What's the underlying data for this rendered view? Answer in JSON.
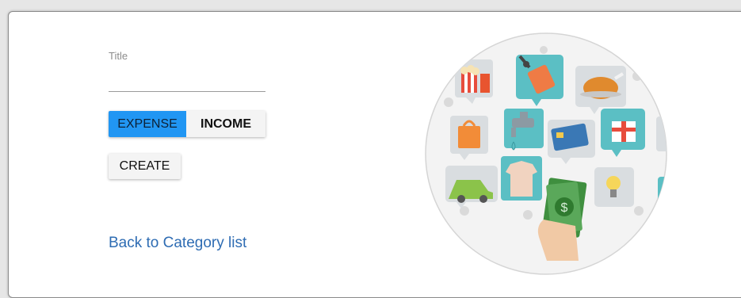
{
  "form": {
    "title_label": "Title",
    "title_value": "",
    "type_options": [
      "EXPENSE",
      "INCOME"
    ],
    "selected_type": "EXPENSE",
    "create_label": "CREATE"
  },
  "back_link_label": "Back to Category list",
  "illustration": {
    "icons": [
      "popcorn-icon",
      "fuel-pump-icon",
      "roast-chicken-icon",
      "shopping-bag-icon",
      "faucet-icon",
      "credit-card-icon",
      "gift-icon",
      "shirt-icon",
      "car-icon",
      "money-hand-icon",
      "lightbulb-icon"
    ]
  },
  "colors": {
    "accent": "#2196f3",
    "link": "#2e6cb3",
    "bubble_teal": "#5bbfc4",
    "money_green": "#4a9a4a"
  }
}
